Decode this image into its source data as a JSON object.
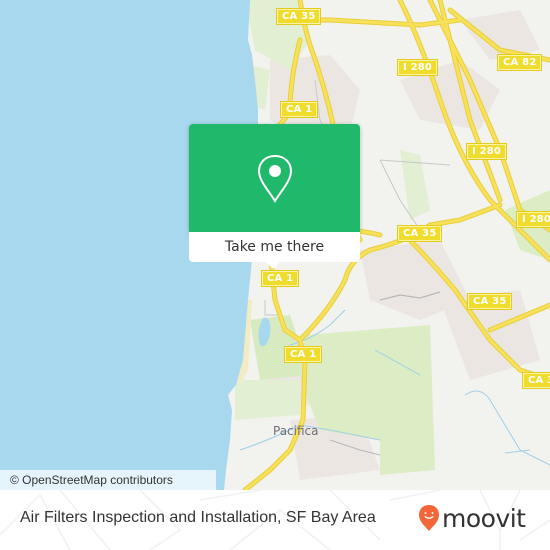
{
  "map": {
    "road_shields": [
      {
        "label": "CA 35"
      },
      {
        "label": "CA 82"
      },
      {
        "label": "I 280"
      },
      {
        "label": "CA 1"
      },
      {
        "label": "I 280"
      },
      {
        "label": "I 280"
      },
      {
        "label": "CA 35"
      },
      {
        "label": "CA 1"
      },
      {
        "label": "CA 35"
      },
      {
        "label": "CA 1"
      },
      {
        "label": "CA 3"
      }
    ],
    "place_labels": [
      {
        "label": "Pacifica"
      }
    ],
    "attribution": "© OpenStreetMap contributors",
    "colors": {
      "water": "#a8d8ee",
      "land": "#f2f2ef",
      "park": "#dcecc4",
      "road": "#f7e05a",
      "urban": "#ece6e2"
    }
  },
  "popup": {
    "icon": "map-pin-icon",
    "action_label": "Take me there",
    "color": "#20b86a"
  },
  "footer": {
    "title": "Air Filters Inspection and Installation, SF Bay Area",
    "brand": "moovit",
    "brand_icon": "moovit-logo-icon",
    "brand_color": "#f2663a"
  }
}
